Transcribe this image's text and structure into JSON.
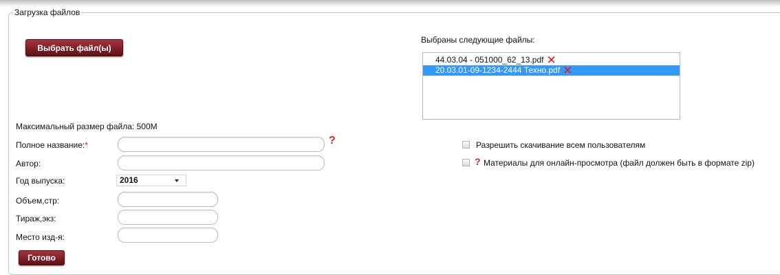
{
  "upload": {
    "legend": "Загрузка файлов",
    "choose_label": "Выбрать файл(ы)",
    "selected_label": "Выбраны следующие файлы:",
    "files": [
      {
        "name": "44.03.04 - 051000_62_13.pdf",
        "selected": false
      },
      {
        "name": "20.03.01-09-1234-2444 Техно.pdf",
        "selected": true
      }
    ],
    "max_size": "Максимальный размер файла: 500M"
  },
  "form": {
    "title_label": "Полное название:",
    "required_mark": "*",
    "help_mark": "?",
    "author_label": "Автор:",
    "year_label": "Год выпуска:",
    "year_value": "2016",
    "volume_label": "Объем,стр:",
    "circulation_label": "Тираж,экз:",
    "place_label": "Место изд-я:",
    "done_label": "Готово"
  },
  "options": {
    "allow_download_label": "Разрешить скачивание всем пользователям",
    "online_help_mark": "?",
    "online_label": "Материалы для онлайн-просмотра (файл должен быть в формате zip)"
  },
  "colors": {
    "button": "#7a1d26",
    "selection": "#3399ff",
    "remove_icon": "#e01b1b"
  }
}
